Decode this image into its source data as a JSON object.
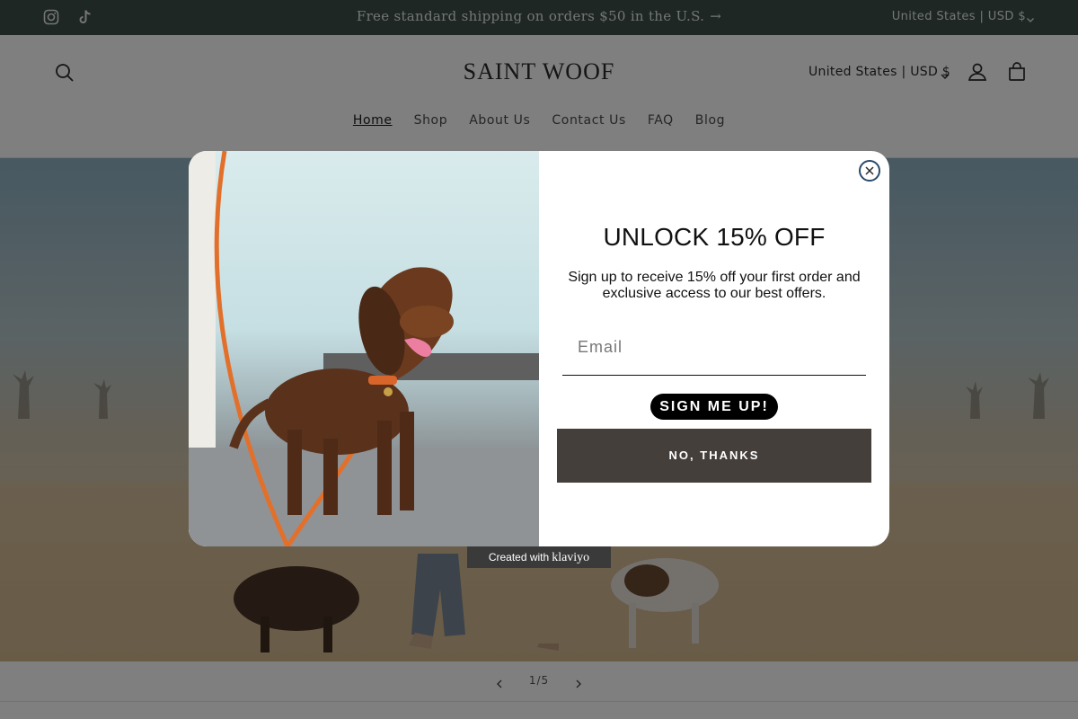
{
  "announcement": {
    "message": "Free standard shipping on orders $50 in the U.S.",
    "arrow": "→",
    "country": "United States | USD $",
    "socials": [
      "instagram-icon",
      "tiktok-icon"
    ]
  },
  "header": {
    "logo": "SAINT WOOF",
    "country": "United States | USD $",
    "icons": [
      "search-icon",
      "account-icon",
      "cart-icon"
    ]
  },
  "nav": [
    {
      "label": "Home",
      "active": true
    },
    {
      "label": "Shop",
      "active": false
    },
    {
      "label": "About Us",
      "active": false
    },
    {
      "label": "Contact Us",
      "active": false
    },
    {
      "label": "FAQ",
      "active": false
    },
    {
      "label": "Blog",
      "active": false
    }
  ],
  "slider": {
    "counter": "1/5"
  },
  "popup": {
    "headline": "UNLOCK 15% OFF",
    "subtext": "Sign up to receive 15% off your first order and exclusive access to our best offers.",
    "email_placeholder": "Email",
    "signup_label": "SIGN ME UP!",
    "decline_label": "NO, THANKS"
  },
  "badge": {
    "prefix": "Created with",
    "brand": "klaviyo"
  },
  "colors": {
    "announcement_bg": "#3d4f48",
    "signup_bg": "#000000",
    "decline_bg": "#453f3b",
    "leash": "#e2702b"
  }
}
